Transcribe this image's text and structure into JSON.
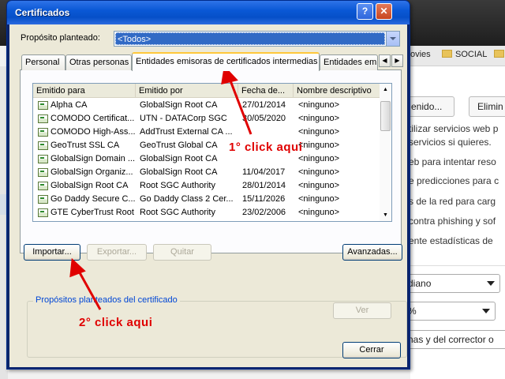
{
  "background": {
    "bookmarks": [
      "ovies",
      "SOCIAL"
    ],
    "buttons": [
      "enido...",
      "Elimin"
    ],
    "text_lines": [
      "tilizar servicios web p",
      "servicios si quieres.",
      "eb para intentar reso",
      "e predicciones para c",
      "s de la red para carg",
      "contra phishing y sof",
      "ente estadísticas de"
    ],
    "selects": [
      "diano",
      "%",
      "nas y del corrector o"
    ]
  },
  "dialog": {
    "title": "Certificados",
    "help_glyph": "?",
    "close_glyph": "✕",
    "purpose_label": "Propósito planteado:",
    "purpose_value": "<Todos>",
    "tabs": [
      "Personal",
      "Otras personas",
      "Entidades emisoras de certificados intermedias",
      "Entidades emi"
    ],
    "tab_scroll_left": "◀",
    "tab_scroll_right": "▶",
    "columns": [
      "Emitido para",
      "Emitido por",
      "Fecha de...",
      "Nombre descriptivo"
    ],
    "rows": [
      {
        "to": "Alpha CA",
        "by": "GlobalSign Root CA",
        "date": "27/01/2014",
        "name": "<ninguno>"
      },
      {
        "to": "COMODO Certificat...",
        "by": "UTN - DATACorp SGC",
        "date": "30/05/2020",
        "name": "<ninguno>"
      },
      {
        "to": "COMODO High-Ass...",
        "by": "AddTrust External CA ...",
        "date": "",
        "name": "<ninguno>"
      },
      {
        "to": "GeoTrust SSL CA",
        "by": "GeoTrust Global CA",
        "date": "",
        "name": "<ninguno>"
      },
      {
        "to": "GlobalSign Domain ...",
        "by": "GlobalSign Root CA",
        "date": "",
        "name": "<ninguno>"
      },
      {
        "to": "GlobalSign Organiz...",
        "by": "GlobalSign Root CA",
        "date": "11/04/2017",
        "name": "<ninguno>"
      },
      {
        "to": "GlobalSign Root CA",
        "by": "Root SGC Authority",
        "date": "28/01/2014",
        "name": "<ninguno>"
      },
      {
        "to": "Go Daddy Secure C...",
        "by": "Go Daddy Class 2 Cer...",
        "date": "15/11/2026",
        "name": "<ninguno>"
      },
      {
        "to": "GTE CyberTrust Root",
        "by": "Root SGC Authority",
        "date": "23/02/2006",
        "name": "<ninguno>"
      }
    ],
    "buttons": {
      "import": "Importar...",
      "export": "Exportar...",
      "remove": "Quitar",
      "advanced": "Avanzadas...",
      "view": "Ver",
      "close": "Cerrar"
    },
    "group_label": "Propósitos planteados del certificado"
  },
  "annotations": {
    "step1": "1° click aqui",
    "step2": "2° click aqui",
    "color": "#e00000"
  },
  "colors": {
    "titlebar": "#0a58d6",
    "selection": "#316ac5",
    "dialog_bg": "#ece9d8",
    "tab_highlight": "#ffc83c",
    "group_label": "#0046d5"
  }
}
